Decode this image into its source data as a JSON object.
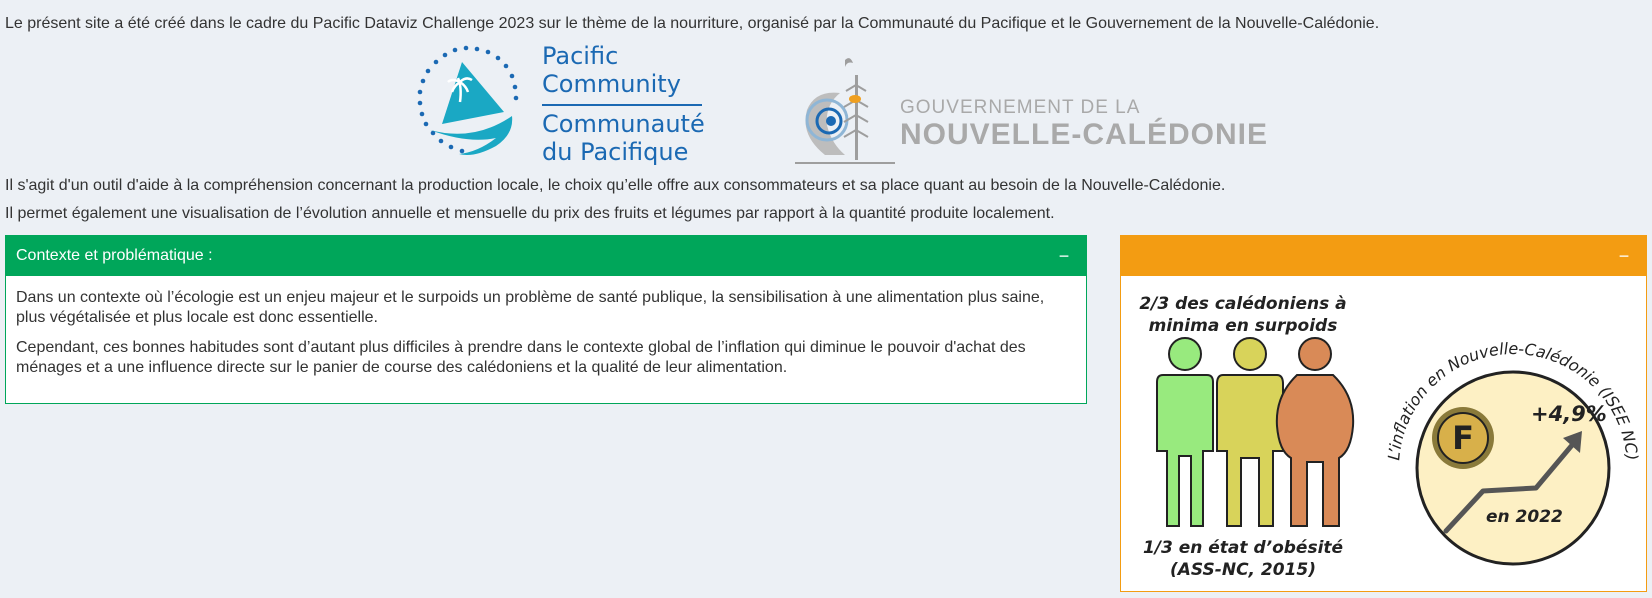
{
  "intro": {
    "line1": "Le présent site a été créé dans le cadre du Pacific Dataviz Challenge 2023 sur le thème de la nourriture, organisé par la Communauté du Pacifique et le Gouvernement de la Nouvelle-Calédonie.",
    "line2": "Il s'agit d'un outil d'aide à la compréhension concernant la production locale, le choix qu’elle offre aux consommateurs et sa place quant au besoin de la Nouvelle-Calédonie.",
    "line3": "Il permet également une visualisation de l’évolution annuelle et mensuelle du prix des fruits et légumes par rapport à la quantité produite localement."
  },
  "logos": {
    "pc": {
      "line1": "Pacific",
      "line2": "Community",
      "line3": "Communauté",
      "line4": "du Pacifique"
    },
    "gnc": {
      "line1": "GOUVERNEMENT DE LA",
      "line2": "NOUVELLE-CALÉDONIE"
    }
  },
  "context_box": {
    "title": "Contexte et problématique :",
    "collapse_label": "−",
    "paragraph1": "Dans un contexte où l’écologie est un enjeu majeur et le surpoids un problème de santé publique, la sensibilisation à une alimentation plus saine, plus végétalisée et plus locale est donc essentielle.",
    "paragraph2": "Cependant, ces bonnes habitudes sont d’autant plus difficiles à prendre dans le contexte global de l’inflation qui diminue le pouvoir d'achat des ménages et a une influence directe sur le panier de course des calédoniens et la qualité de leur alimentation."
  },
  "info_box": {
    "collapse_label": "−",
    "obesity": {
      "top_line1": "2/3 des calédoniens à",
      "top_line2": "minima en surpoids",
      "bottom_line1": "1/3 en état d’obésité",
      "bottom_line2": "(ASS-NC, 2015)"
    },
    "inflation": {
      "arc_text": "L’inflation en Nouvelle-Calédonie (ISEE NC)",
      "coin_letter": "F",
      "rate": "+4,9%",
      "year": "en 2022"
    }
  },
  "colors": {
    "green": "#00a65a",
    "orange": "#f39c12",
    "figure_green": "#98ea7e",
    "figure_yellow": "#d8d35a",
    "figure_orange": "#d98a57",
    "circle_fill": "#fdf0c4",
    "coin": "#d8b04a"
  }
}
